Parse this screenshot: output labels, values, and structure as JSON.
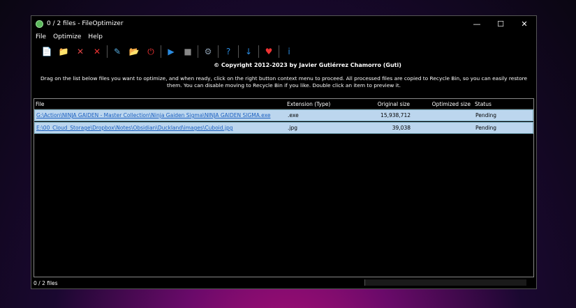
{
  "window": {
    "title": "0 / 2 files - FileOptimizer",
    "minimize": "—",
    "maximize": "☐",
    "close": "✕"
  },
  "menu": [
    "File",
    "Optimize",
    "Help"
  ],
  "toolbar": [
    {
      "icon": "add-files-icon",
      "glyph": "📄",
      "color": "#8ac"
    },
    {
      "icon": "add-folder-icon",
      "glyph": "📁",
      "color": "#e8c040"
    },
    {
      "icon": "remove-icon",
      "glyph": "✕",
      "color": "#d44"
    },
    {
      "icon": "clear-icon",
      "glyph": "✕",
      "color": "#e33"
    },
    {
      "sep": true
    },
    {
      "icon": "edit-icon",
      "glyph": "✎",
      "color": "#5ad"
    },
    {
      "icon": "open-folder-icon",
      "glyph": "📂",
      "color": "#ec4"
    },
    {
      "icon": "power-icon",
      "glyph": "⏻",
      "color": "#e33"
    },
    {
      "sep": true
    },
    {
      "icon": "play-icon",
      "glyph": "▶",
      "color": "#2a8be0"
    },
    {
      "icon": "stop-icon",
      "glyph": "■",
      "color": "#888"
    },
    {
      "sep": true
    },
    {
      "icon": "gear-icon",
      "glyph": "⚙",
      "color": "#89a"
    },
    {
      "sep": true
    },
    {
      "icon": "help-icon",
      "glyph": "?",
      "color": "#2a8be0"
    },
    {
      "sep": true
    },
    {
      "icon": "update-icon",
      "glyph": "↓",
      "color": "#2a8be0"
    },
    {
      "sep": true
    },
    {
      "icon": "heart-icon",
      "glyph": "♥",
      "color": "#e33"
    },
    {
      "sep": true
    },
    {
      "icon": "info-icon",
      "glyph": "i",
      "color": "#2a8be0"
    }
  ],
  "copyright": "© Copyright 2012-2023 by Javier Gutiérrez Chamorro (Guti)",
  "description": "Drag on the list below files you want to optimize, and when ready, click on the right button context menu to proceed. All processed files are copied to Recycle Bin, so you can easily restore them. You can disable moving to Recycle Bin if you like. Double click an item to preview it.",
  "columns": [
    "File",
    "Extension (Type)",
    "Original size",
    "Optimized size",
    "Status"
  ],
  "rows": [
    {
      "file": "G:\\Action\\NINJA GAIDEN - Master Collection\\Ninja Gaiden Sigma\\NINJA GAIDEN SIGMA.exe",
      "ext": ".exe",
      "orig": "15,938,712",
      "opt": "",
      "status": "Pending"
    },
    {
      "file": "E:\\00_Cloud_Storage\\Dropbox\\Notes\\Obsidian\\Duckland\\images\\Cuboid.jpg",
      "ext": ".jpg",
      "orig": "39,038",
      "opt": "",
      "status": "Pending"
    }
  ],
  "statusbar": {
    "text": "0 / 2 files",
    "progress": 0
  }
}
